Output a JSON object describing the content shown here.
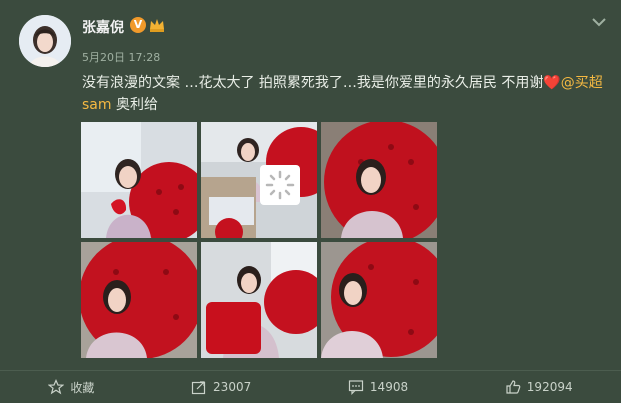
{
  "post": {
    "username": "张嘉倪",
    "verified_badge": "V",
    "timestamp": "5月20日 17:28",
    "text_part1": "没有浪漫的文案 …花太大了 拍照累死我了…我是你爱里的永久居民 不用谢",
    "heart": "❤️",
    "mention": "@买超sam",
    "text_part2": " 奥利给"
  },
  "images": [
    {
      "alt": "photo-1"
    },
    {
      "alt": "photo-2"
    },
    {
      "alt": "photo-3"
    },
    {
      "alt": "photo-4"
    },
    {
      "alt": "photo-5"
    },
    {
      "alt": "photo-6"
    }
  ],
  "footer": {
    "favorite_label": "收藏",
    "repost_count": "23007",
    "comment_count": "14908",
    "like_count": "192094"
  },
  "colors": {
    "background": "#3b4b3e",
    "mention": "#f5b942",
    "heart": "#e94b3c"
  },
  "icons": [
    "star-icon",
    "repost-icon",
    "comment-icon",
    "like-icon",
    "chevron-down-icon",
    "crown-icon",
    "loading-icon"
  ]
}
